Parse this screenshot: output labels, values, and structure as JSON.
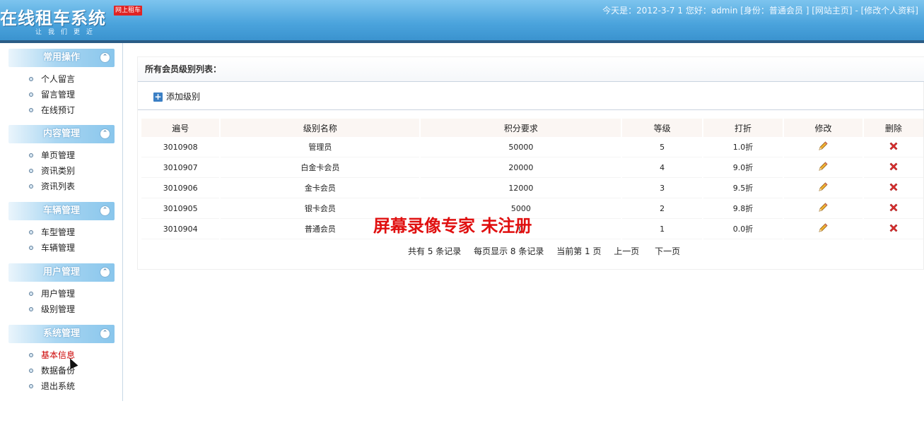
{
  "header": {
    "logo_text": "在线租车系统",
    "slogan": "让我们更近",
    "badge": "网上租车",
    "today_label": "今天是：",
    "date": "2012-3-7 1",
    "greeting": "您好：admin [身份：普通会员 ]",
    "home_link": "[网站主页]",
    "separator": "-",
    "profile_link": "[修改个人资料]"
  },
  "sidebar": {
    "groups": [
      {
        "title": "常用操作",
        "items": [
          "个人留言",
          "留言管理",
          "在线预订"
        ]
      },
      {
        "title": "内容管理",
        "items": [
          "单页管理",
          "资讯类别",
          "资讯列表"
        ]
      },
      {
        "title": "车辆管理",
        "items": [
          "车型管理",
          "车辆管理"
        ]
      },
      {
        "title": "用户管理",
        "items": [
          "用户管理",
          "级别管理"
        ]
      },
      {
        "title": "系统管理",
        "items": [
          "基本信息",
          "数据备份",
          "退出系统"
        ]
      }
    ],
    "collapse_glyph": "⌃"
  },
  "main": {
    "panel_title": "所有会员级别列表：",
    "add_label": "添加级别",
    "columns": [
      "遍号",
      "级别名称",
      "积分要求",
      "等级",
      "打折",
      "修改",
      "删除"
    ],
    "rows": [
      {
        "id": "3010908",
        "name": "管理员",
        "points": "50000",
        "level": "5",
        "discount": "1.0折"
      },
      {
        "id": "3010907",
        "name": "白金卡会员",
        "points": "20000",
        "level": "4",
        "discount": "9.0折"
      },
      {
        "id": "3010906",
        "name": "金卡会员",
        "points": "12000",
        "level": "3",
        "discount": "9.5折"
      },
      {
        "id": "3010905",
        "name": "银卡会员",
        "points": "5000",
        "level": "2",
        "discount": "9.8折"
      },
      {
        "id": "3010904",
        "name": "普通会员",
        "points": "0",
        "level": "1",
        "discount": "0.0折"
      }
    ],
    "pager": {
      "total": "共有 5 条记录",
      "per_page": "每页显示 8 条记录",
      "current": "当前第 1 页",
      "prev": "上一页",
      "next": "下一页"
    }
  },
  "watermark": "屏幕录像专家  未注册",
  "colors": {
    "header": "#4aa3dc",
    "points": "#c00000",
    "link": "#1f4e8c",
    "delete": "#e03030",
    "active_menu": "#cc0000"
  }
}
